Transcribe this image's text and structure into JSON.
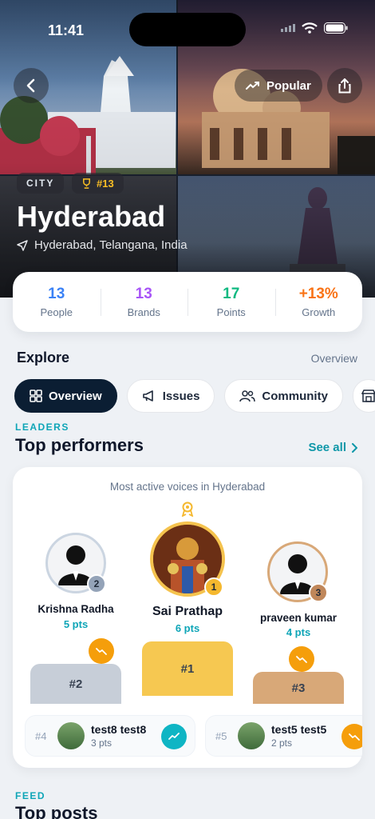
{
  "status_bar": {
    "time": "11:41"
  },
  "hero": {
    "popular_label": "Popular",
    "chip_type": "CITY",
    "chip_rank": "#13",
    "title": "Hyderabad",
    "location": "Hyderabad, Telangana, India"
  },
  "stats": [
    {
      "value": "13",
      "label": "People",
      "color": "#3b82f6"
    },
    {
      "value": "13",
      "label": "Brands",
      "color": "#a855f7"
    },
    {
      "value": "17",
      "label": "Points",
      "color": "#10b981"
    },
    {
      "value": "+13%",
      "label": "Growth",
      "color": "#f97316"
    }
  ],
  "explore": {
    "title": "Explore",
    "link": "Overview",
    "tabs": [
      {
        "label": "Overview",
        "icon": "grid-icon"
      },
      {
        "label": "Issues",
        "icon": "megaphone-icon"
      },
      {
        "label": "Community",
        "icon": "people-icon"
      },
      {
        "label": "",
        "icon": "store-icon"
      }
    ]
  },
  "leaders": {
    "eyebrow": "LEADERS",
    "title": "Top performers",
    "see_all": "See all",
    "subtitle": "Most active voices in Hyderabad",
    "podium": [
      {
        "rank": "2",
        "name": "Krishna Radha",
        "pts": "5 pts",
        "slot": "#2",
        "color": "#cbd5e1",
        "badge_color": "#94a3b8"
      },
      {
        "rank": "1",
        "name": "Sai Prathap",
        "pts": "6 pts",
        "slot": "#1",
        "color": "#f6c851",
        "badge_color": "#f5b82e"
      },
      {
        "rank": "3",
        "name": "praveen kumar",
        "pts": "4 pts",
        "slot": "#3",
        "color": "#d8a878",
        "badge_color": "#c0875a"
      }
    ],
    "runners": [
      {
        "rank": "#4",
        "name": "test8  test8",
        "pts": "3 pts",
        "trend_color": "#0fb5c4"
      },
      {
        "rank": "#5",
        "name": "test5  test5",
        "pts": "2 pts",
        "trend_color": "#f59e0b"
      }
    ]
  },
  "feed": {
    "eyebrow": "FEED",
    "title": "Top posts"
  }
}
